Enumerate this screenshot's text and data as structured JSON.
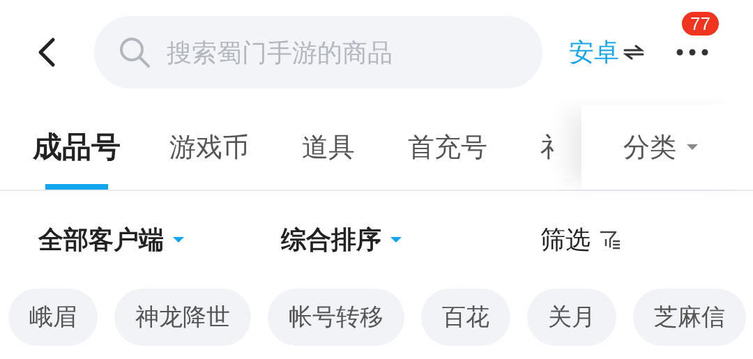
{
  "search": {
    "placeholder": "搜索蜀门手游的商品"
  },
  "platform": {
    "label": "安卓",
    "selected": true
  },
  "more": {
    "badge": "77"
  },
  "tabs": [
    {
      "label": "成品号",
      "selected": true
    },
    {
      "label": "游戏币",
      "selected": false
    },
    {
      "label": "道具",
      "selected": false
    },
    {
      "label": "首充号",
      "selected": false
    },
    {
      "label": "礻",
      "selected": false
    }
  ],
  "category": {
    "label": "分类"
  },
  "filters": [
    {
      "label": "全部客户端",
      "kind": "dropdown"
    },
    {
      "label": "综合排序",
      "kind": "dropdown"
    },
    {
      "label": "筛选",
      "kind": "filter"
    }
  ],
  "chips": [
    "峨眉",
    "神龙降世",
    "帐号转移",
    "百花",
    "关月",
    "芝麻信"
  ]
}
